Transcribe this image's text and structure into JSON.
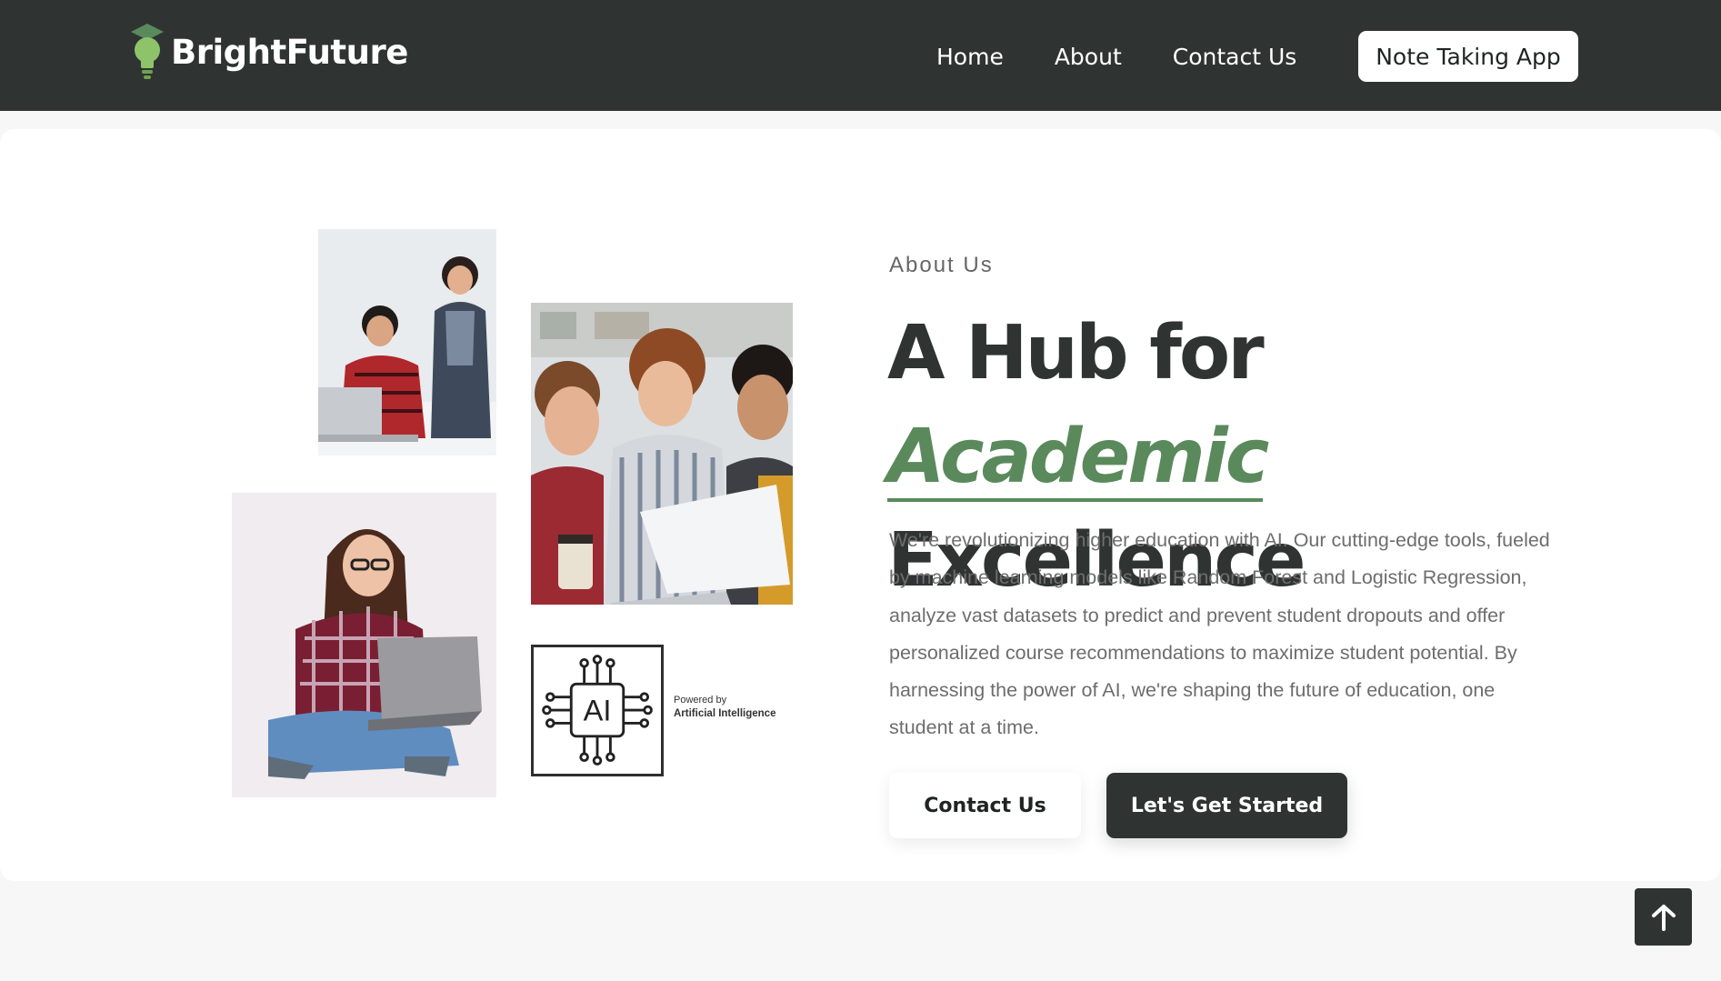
{
  "colors": {
    "nav_bg": "#2f3433",
    "accent_green": "#5a8a5c",
    "dark_button": "#2f3433",
    "body_text": "#6d6d6d"
  },
  "navbar": {
    "logo_icon": "lightbulb-graduation-cap-icon",
    "brand": "BrightFuture",
    "links": [
      "Home",
      "About",
      "Contact Us"
    ],
    "cta": "Note Taking App"
  },
  "about": {
    "eyebrow": "About Us",
    "headline_part1": "A Hub for ",
    "headline_accent": "Academic",
    "headline_part2": "Excellence",
    "description": "We're revolutionizing higher education with AI. Our cutting-edge tools, fueled by machine learning models like Random Forest and Logistic Regression, analyze vast datasets to predict and prevent student dropouts and offer personalized course recommendations to maximize student potential. By harnessing the power of AI, we're shaping the future of education, one student at a time.",
    "buttons": {
      "contact": "Contact Us",
      "get_started": "Let's Get Started"
    }
  },
  "images": {
    "ai_chip_text": "AI",
    "ai_caption_small": "Powered by",
    "ai_caption_bold": "Artificial Intelligence"
  },
  "scroll_top": {
    "icon": "arrow-up-icon"
  }
}
